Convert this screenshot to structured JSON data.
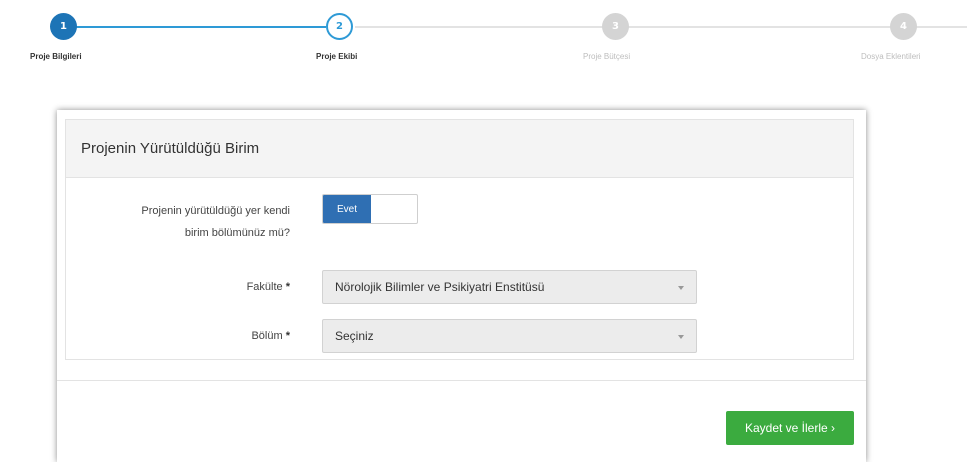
{
  "stepper": {
    "steps": [
      {
        "number": "1",
        "label": "Proje Bilgileri",
        "state": "completed"
      },
      {
        "number": "2",
        "label": "Proje Ekibi",
        "state": "current"
      },
      {
        "number": "3",
        "label": "Proje Bütçesi",
        "state": "pending"
      },
      {
        "number": "4",
        "label": "Dosya Eklentileri",
        "state": "pending"
      }
    ]
  },
  "panel": {
    "title": "Projenin Yürütüldüğü Birim"
  },
  "form": {
    "own_unit_label_line1": "Projenin yürütüldüğü yer kendi",
    "own_unit_label_line2": "birim bölümünüz mü?",
    "toggle_value": "Evet",
    "faculty_label": "Fakülte",
    "faculty_value": "Nörolojik Bilimler ve Psikiyatri Enstitüsü",
    "department_label": "Bölüm",
    "department_value": "Seçiniz",
    "required_mark": "*"
  },
  "actions": {
    "save_label": "Kaydet ve İlerle ›"
  },
  "colors": {
    "accent_blue": "#1d74b6",
    "line_blue": "#2e9ad6",
    "toggle_blue": "#2f6fb3",
    "success_green": "#3bab3f"
  }
}
